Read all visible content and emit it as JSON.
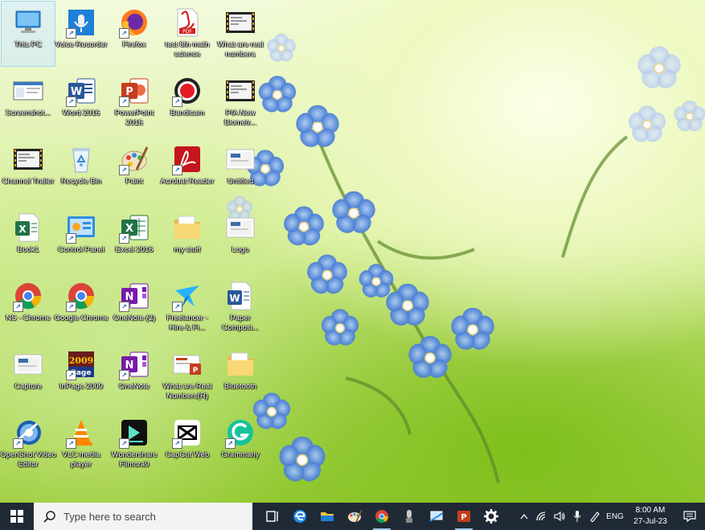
{
  "desktop_icons": [
    {
      "label": "This PC",
      "icon": "this-pc-icon",
      "shortcut": false,
      "selected": true
    },
    {
      "label": "Voice Recorder",
      "icon": "voice-recorder-icon",
      "shortcut": true
    },
    {
      "label": "Firefox",
      "icon": "firefox-icon",
      "shortcut": true
    },
    {
      "label": "test 8th math science",
      "icon": "pdf-file-icon",
      "shortcut": false
    },
    {
      "label": "What are real numbers",
      "icon": "video-file-icon",
      "shortcut": false
    },
    {
      "label": "Screenshot...",
      "icon": "screenshot-file-icon",
      "shortcut": false
    },
    {
      "label": "Word 2016",
      "icon": "word-icon",
      "shortcut": true
    },
    {
      "label": "PowerPoint 2016",
      "icon": "powerpoint-icon",
      "shortcut": true
    },
    {
      "label": "Bandicam",
      "icon": "bandicam-icon",
      "shortcut": true
    },
    {
      "label": "PIA New Biometr...",
      "icon": "video-file-icon",
      "shortcut": false
    },
    {
      "label": "Channel Trailer",
      "icon": "video-file-icon",
      "shortcut": false
    },
    {
      "label": "Recycle Bin",
      "icon": "recycle-bin-icon",
      "shortcut": false
    },
    {
      "label": "Paint",
      "icon": "paint-icon",
      "shortcut": true
    },
    {
      "label": "Acrobat Reader",
      "icon": "acrobat-icon",
      "shortcut": true
    },
    {
      "label": "Untitled",
      "icon": "image-file-icon",
      "shortcut": false
    },
    {
      "label": "Book1",
      "icon": "excel-file-icon",
      "shortcut": false
    },
    {
      "label": "Control Panel",
      "icon": "control-panel-icon",
      "shortcut": true
    },
    {
      "label": "Excel 2016",
      "icon": "excel-icon",
      "shortcut": true
    },
    {
      "label": "my stuff",
      "icon": "folder-icon",
      "shortcut": false
    },
    {
      "label": "Logo",
      "icon": "image-file-icon",
      "shortcut": false
    },
    {
      "label": "NS - Chrome",
      "icon": "chrome-icon",
      "shortcut": true
    },
    {
      "label": "Google Chrome",
      "icon": "chrome-icon",
      "shortcut": true
    },
    {
      "label": "OneNote (2)",
      "icon": "onenote-icon",
      "shortcut": true
    },
    {
      "label": "Freelancer - Hire & Fi...",
      "icon": "freelancer-icon",
      "shortcut": true
    },
    {
      "label": "Paper Composi...",
      "icon": "word-file-icon",
      "shortcut": false
    },
    {
      "label": "Capture",
      "icon": "image-file-icon",
      "shortcut": false
    },
    {
      "label": "InPage 2009",
      "icon": "inpage-icon",
      "shortcut": true
    },
    {
      "label": "OneNote",
      "icon": "onenote-icon",
      "shortcut": true
    },
    {
      "label": "What are Real Numbers(R)",
      "icon": "pptx-file-icon",
      "shortcut": false
    },
    {
      "label": "Bluetooth",
      "icon": "folder-icon",
      "shortcut": false
    },
    {
      "label": "OpenShot Video Editor",
      "icon": "openshot-icon",
      "shortcut": true
    },
    {
      "label": "VLC media player",
      "icon": "vlc-icon",
      "shortcut": true
    },
    {
      "label": "Wondershare Filmora9",
      "icon": "filmora-icon",
      "shortcut": true
    },
    {
      "label": "CapCut Web",
      "icon": "capcut-icon",
      "shortcut": true
    },
    {
      "label": "Grammarly",
      "icon": "grammarly-icon",
      "shortcut": true
    }
  ],
  "taskbar": {
    "search_placeholder": "Type here to search",
    "apps": [
      {
        "name": "task-view",
        "icon": "task-view-icon"
      },
      {
        "name": "edge",
        "icon": "edge-icon"
      },
      {
        "name": "file-explorer",
        "icon": "file-explorer-icon"
      },
      {
        "name": "paint",
        "icon": "paint-icon"
      },
      {
        "name": "chrome",
        "icon": "chrome-icon",
        "active": true
      },
      {
        "name": "voice-recorder",
        "icon": "voice-recorder-icon"
      },
      {
        "name": "screen-tool",
        "icon": "screen-tool-icon"
      },
      {
        "name": "powerpoint",
        "icon": "powerpoint-icon",
        "active": true
      },
      {
        "name": "settings",
        "icon": "gear-icon"
      }
    ],
    "tray": {
      "language": "ENG",
      "time": "8:00 AM",
      "date": "27-Jul-23"
    }
  },
  "colors": {
    "taskbar": "#1f2a36",
    "search_box": "#f3f3f3",
    "label_text": "#ffffff"
  }
}
